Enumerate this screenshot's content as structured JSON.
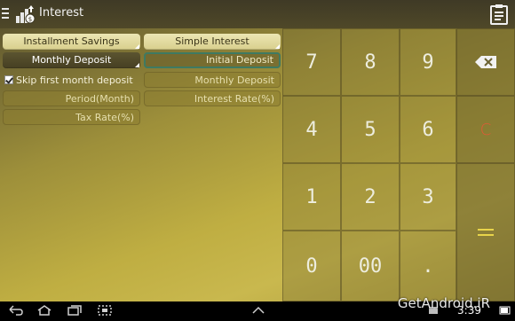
{
  "app": {
    "title": "Interest"
  },
  "tabs": {
    "installment_savings": "Installment Savings",
    "simple_interest": "Simple Interest",
    "monthly_deposit": "Monthly Deposit"
  },
  "form": {
    "initial_deposit": "Initial Deposit",
    "skip_first_month": "Skip first month deposit",
    "skip_first_month_checked": true,
    "monthly_deposit": "Monthly Deposit",
    "period": "Period(Month)",
    "interest_rate": "Interest Rate(%)",
    "tax_rate": "Tax Rate(%)"
  },
  "keypad": {
    "keys": [
      "7",
      "8",
      "9",
      "4",
      "5",
      "6",
      "1",
      "2",
      "3",
      "0",
      "00",
      "."
    ],
    "clear": "C",
    "backspace_icon": "backspace-icon",
    "equals_icon": "equals-icon"
  },
  "status": {
    "time": "3:39",
    "watermark": "GetAndroid.iR"
  },
  "colors": {
    "accent": "#3e7a62",
    "clear": "#e05a36",
    "equals": "#e8d44a"
  }
}
